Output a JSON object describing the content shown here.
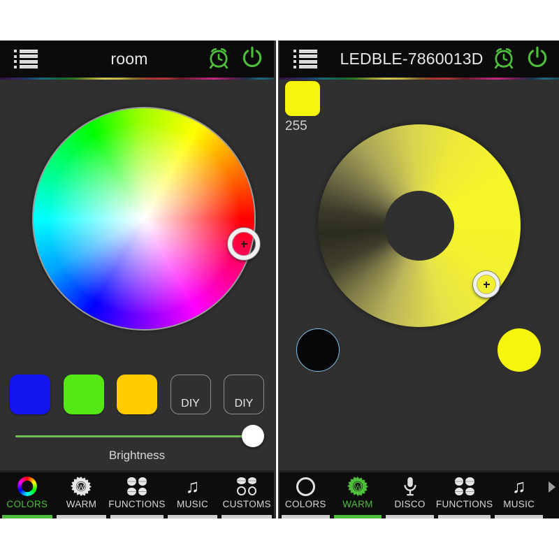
{
  "app": {
    "accent_green": "#4fbe3c",
    "panel_bg": "#303030",
    "header_bg": "#0b0b0b"
  },
  "left_panel": {
    "header": {
      "menu_icon": "list-menu-icon",
      "title": "room",
      "alarm_icon": "alarm-clock-icon",
      "power_icon": "power-icon"
    },
    "color_wheel": {
      "name": "hsv-color-wheel",
      "handle_icon": "crosshair-handle-icon"
    },
    "presets": [
      {
        "label": "",
        "color": "#1414f0",
        "type": "color"
      },
      {
        "label": "",
        "color": "#55e814",
        "type": "color"
      },
      {
        "label": "",
        "color": "#ffcc00",
        "type": "color"
      },
      {
        "label": "DIY",
        "color": "",
        "type": "diy"
      },
      {
        "label": "DIY",
        "color": "",
        "type": "diy"
      }
    ],
    "brightness": {
      "label": "Brightness",
      "value": 100,
      "track_color": "#6fbf5a"
    },
    "nav": [
      {
        "label": "COLORS",
        "icon": "rainbow-ring-icon",
        "active": true
      },
      {
        "label": "WARM",
        "icon": "warm-gear-icon",
        "active": false
      },
      {
        "label": "FUNCTIONS",
        "icon": "quad-dots-icon",
        "active": false
      },
      {
        "label": "MUSIC",
        "icon": "music-note-icon",
        "active": false
      },
      {
        "label": "CUSTOMS",
        "icon": "quad-mixed-icon",
        "active": false
      }
    ]
  },
  "right_panel": {
    "header": {
      "menu_icon": "list-menu-icon",
      "title": "LEDBLE-7860013D",
      "alarm_icon": "alarm-clock-icon",
      "power_icon": "power-icon"
    },
    "mini_swatch": {
      "color": "#f5f50d",
      "value": "255"
    },
    "warm_wheel": {
      "name": "warm-white-wheel",
      "handle_icon": "crosshair-handle-icon"
    },
    "circles": [
      {
        "name": "warm-off-circle",
        "color": "#050608",
        "border": "#7fc4e8"
      },
      {
        "name": "warm-full-circle",
        "color": "#f5f50d",
        "border": ""
      }
    ],
    "nav": [
      {
        "label": "COLORS",
        "icon": "plain-ring-icon",
        "active": false
      },
      {
        "label": "WARM",
        "icon": "warm-gear-icon",
        "active": true
      },
      {
        "label": "DISCO",
        "icon": "microphone-icon",
        "active": false
      },
      {
        "label": "FUNCTIONS",
        "icon": "quad-dots-icon",
        "active": false
      },
      {
        "label": "MUSIC",
        "icon": "music-note-icon",
        "active": false
      }
    ],
    "more_arrow": "chevron-right-icon"
  }
}
